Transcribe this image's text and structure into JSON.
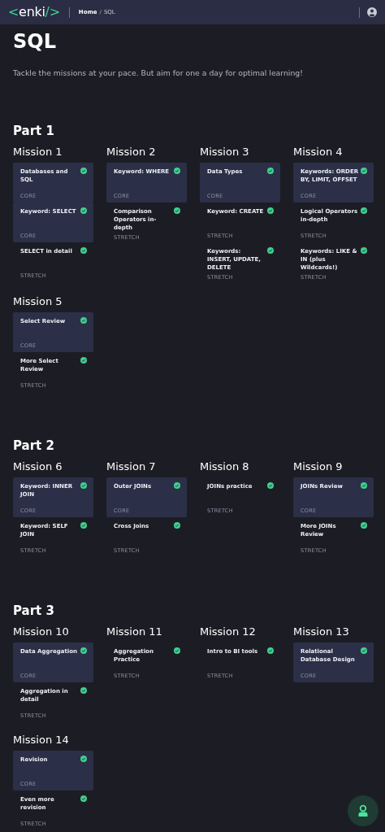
{
  "navbar": {
    "logo": {
      "open": "<",
      "name": "enki",
      "close": "/>"
    },
    "breadcrumb": [
      {
        "label": "Home"
      },
      {
        "label": "SQL"
      }
    ],
    "breadcrumb_separator": "/"
  },
  "title": "SQL",
  "tagline": "Tackle the missions at your pace. But aim for one a day for optimal learning!",
  "parts": [
    {
      "title": "Part 1",
      "missions": [
        {
          "title": "Mission 1",
          "lessons": [
            {
              "title": "Databases and SQL",
              "tag": "CORE",
              "kind": "core",
              "completed": true
            },
            {
              "title": "Keyword: SELECT",
              "tag": "CORE",
              "kind": "core",
              "completed": true
            },
            {
              "title": "SELECT in detail",
              "tag": "STRETCH",
              "kind": "stretch",
              "completed": true
            }
          ]
        },
        {
          "title": "Mission 2",
          "lessons": [
            {
              "title": "Keyword: WHERE",
              "tag": "CORE",
              "kind": "core",
              "completed": true
            },
            {
              "title": "Comparison Operators in-depth",
              "tag": "STRETCH",
              "kind": "stretch",
              "completed": true
            }
          ]
        },
        {
          "title": "Mission 3",
          "lessons": [
            {
              "title": "Data Types",
              "tag": "CORE",
              "kind": "core",
              "completed": true
            },
            {
              "title": "Keyword: CREATE",
              "tag": "STRETCH",
              "kind": "stretch",
              "completed": true
            },
            {
              "title": "Keywords: INSERT, UPDATE, DELETE",
              "tag": "STRETCH",
              "kind": "stretch",
              "completed": true
            }
          ]
        },
        {
          "title": "Mission 4",
          "lessons": [
            {
              "title": "Keywords: ORDER BY, LIMIT, OFFSET",
              "tag": "CORE",
              "kind": "core",
              "completed": true
            },
            {
              "title": "Logical Operators in-depth",
              "tag": "STRETCH",
              "kind": "stretch",
              "completed": true
            },
            {
              "title": "Keywords: LIKE & IN (plus Wildcards!)",
              "tag": "STRETCH",
              "kind": "stretch",
              "completed": true
            }
          ]
        },
        {
          "title": "Mission 5",
          "lessons": [
            {
              "title": "Select Review",
              "tag": "CORE",
              "kind": "core",
              "completed": true
            },
            {
              "title": "More Select Review",
              "tag": "STRETCH",
              "kind": "stretch",
              "completed": true
            }
          ]
        }
      ]
    },
    {
      "title": "Part 2",
      "missions": [
        {
          "title": "Mission 6",
          "lessons": [
            {
              "title": "Keyword: INNER JOIN",
              "tag": "CORE",
              "kind": "core",
              "completed": true
            },
            {
              "title": "Keyword: SELF JOIN",
              "tag": "STRETCH",
              "kind": "stretch",
              "completed": true
            }
          ]
        },
        {
          "title": "Mission 7",
          "lessons": [
            {
              "title": "Outer JOINs",
              "tag": "CORE",
              "kind": "core",
              "completed": true
            },
            {
              "title": "Cross Joins",
              "tag": "STRETCH",
              "kind": "stretch",
              "completed": true
            }
          ]
        },
        {
          "title": "Mission 8",
          "lessons": [
            {
              "title": "JOINs practice",
              "tag": "STRETCH",
              "kind": "stretch",
              "completed": true
            }
          ]
        },
        {
          "title": "Mission 9",
          "lessons": [
            {
              "title": "JOINs Review",
              "tag": "CORE",
              "kind": "core",
              "completed": true
            },
            {
              "title": "More JOINs Review",
              "tag": "STRETCH",
              "kind": "stretch",
              "completed": true
            }
          ]
        }
      ]
    },
    {
      "title": "Part 3",
      "missions": [
        {
          "title": "Mission 10",
          "lessons": [
            {
              "title": "Data Aggregation",
              "tag": "CORE",
              "kind": "core",
              "completed": true
            },
            {
              "title": "Aggregation in detail",
              "tag": "STRETCH",
              "kind": "stretch",
              "completed": true
            }
          ]
        },
        {
          "title": "Mission 11",
          "lessons": [
            {
              "title": "Aggregation Practice",
              "tag": "STRETCH",
              "kind": "stretch",
              "completed": true
            }
          ]
        },
        {
          "title": "Mission 12",
          "lessons": [
            {
              "title": "Intro to BI tools",
              "tag": "STRETCH",
              "kind": "stretch",
              "completed": true
            }
          ]
        },
        {
          "title": "Mission 13",
          "lessons": [
            {
              "title": "Relational Database Design",
              "tag": "CORE",
              "kind": "core",
              "completed": true
            }
          ]
        },
        {
          "title": "Mission 14",
          "lessons": [
            {
              "title": "Revision",
              "tag": "CORE",
              "kind": "core",
              "completed": true
            },
            {
              "title": "Even more revision",
              "tag": "STRETCH",
              "kind": "stretch",
              "completed": true
            }
          ]
        }
      ]
    }
  ]
}
